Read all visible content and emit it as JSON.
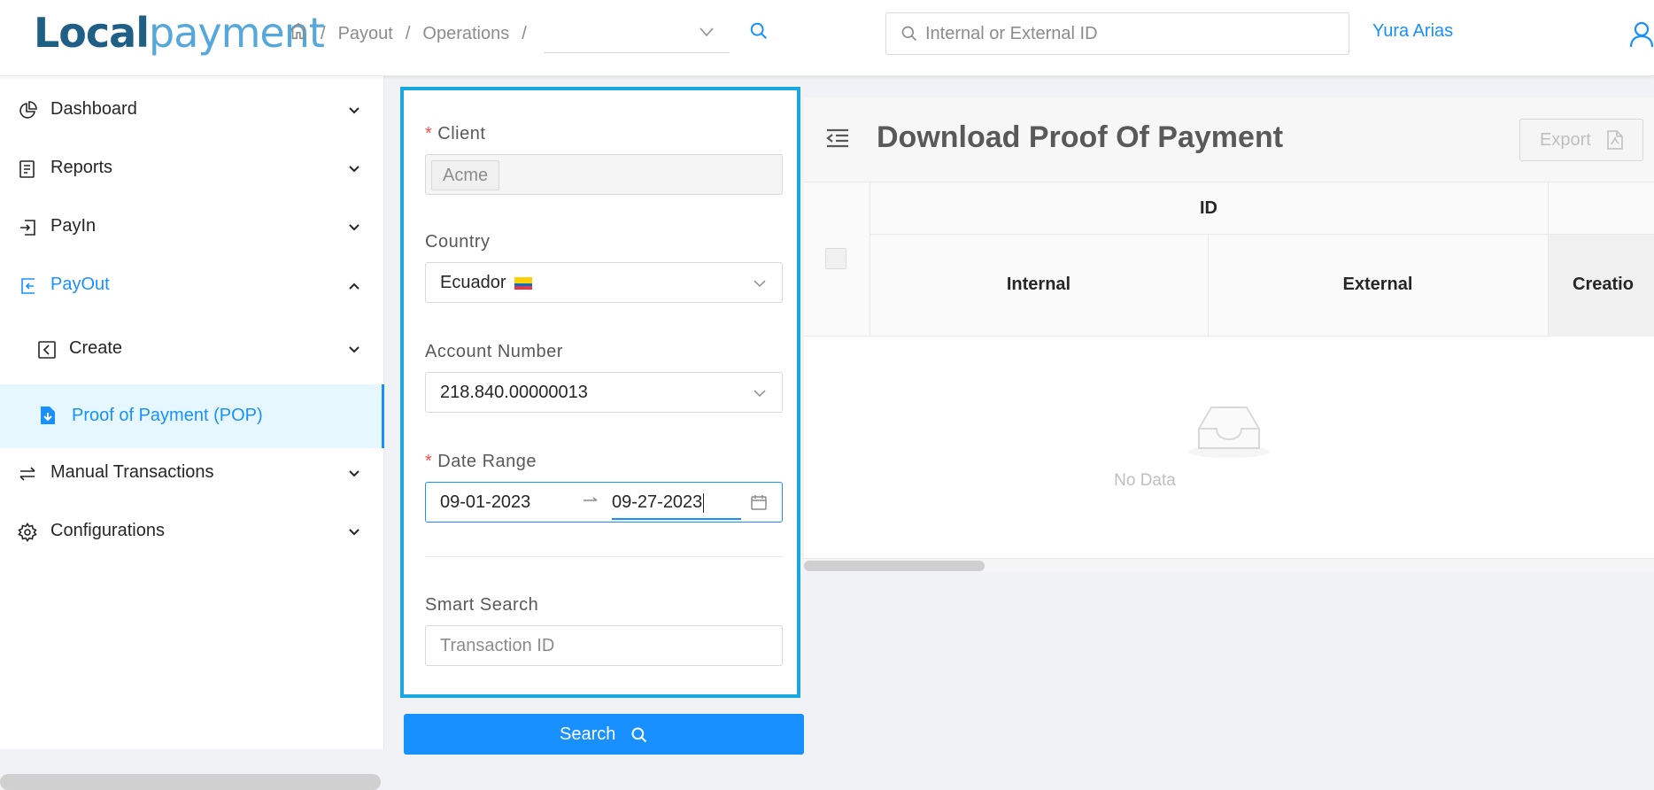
{
  "header": {
    "logo_part1": "Local",
    "logo_part2": "payment",
    "breadcrumb": [
      "Payout",
      "Operations"
    ],
    "breadcrumb_select_value": "",
    "id_search_placeholder": "Internal or External ID",
    "user_name": "Yura Arias"
  },
  "sidebar": {
    "items": [
      {
        "label": "Dashboard",
        "icon": "pie-chart-icon",
        "chevron": "chevron-down-icon"
      },
      {
        "label": "Reports",
        "icon": "report-icon",
        "chevron": "chevron-down-icon"
      },
      {
        "label": "PayIn",
        "icon": "login-icon",
        "chevron": "chevron-down-icon"
      },
      {
        "label": "PayOut",
        "icon": "logout-icon",
        "chevron": "chevron-up-icon"
      },
      {
        "label": "Create",
        "icon": "left-square-icon",
        "chevron": "chevron-down-icon"
      },
      {
        "label": "Proof of Payment (POP)",
        "icon": "file-download-icon"
      },
      {
        "label": "Manual Transactions",
        "icon": "swap-icon",
        "chevron": "chevron-down-icon"
      },
      {
        "label": "Configurations",
        "icon": "gear-icon",
        "chevron": "chevron-down-icon"
      }
    ]
  },
  "filters": {
    "client_label": "Client",
    "client_value": "Acme",
    "country_label": "Country",
    "country_value": "Ecuador",
    "account_label": "Account Number",
    "account_value": "218.840.00000013",
    "date_label": "Date Range",
    "date_start": "09-01-2023",
    "date_end": "09-27-2023",
    "smart_search_label": "Smart Search",
    "smart_search_placeholder": "Transaction ID",
    "search_button": "Search"
  },
  "main": {
    "title": "Download Proof Of Payment",
    "export_label": "Export",
    "table": {
      "group_header": "ID",
      "columns": [
        "Internal",
        "External",
        "Creatio"
      ]
    },
    "empty_text": "No Data"
  },
  "colors": {
    "accent": "#1890ff",
    "panel_border": "#1aa7e0",
    "required": "#ff4d4f"
  }
}
